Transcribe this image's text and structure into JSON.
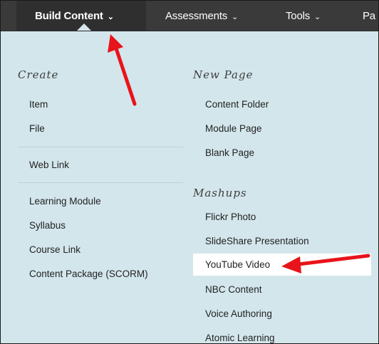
{
  "menubar": {
    "tabs": [
      {
        "label": "Build Content",
        "chevron": "⌄"
      },
      {
        "label": "Assessments",
        "chevron": "⌄"
      },
      {
        "label": "Tools",
        "chevron": "⌄"
      },
      {
        "label": "Pa"
      }
    ]
  },
  "dropdown": {
    "create": {
      "title": "Create",
      "items": [
        "Item",
        "File",
        "Web Link",
        "Learning Module",
        "Syllabus",
        "Course Link",
        "Content Package (SCORM)"
      ]
    },
    "new_page": {
      "title": "New Page",
      "items": [
        "Content Folder",
        "Module Page",
        "Blank Page"
      ]
    },
    "mashups": {
      "title": "Mashups",
      "items": [
        "Flickr Photo",
        "SlideShare Presentation",
        "YouTube Video",
        "NBC Content",
        "Voice Authoring",
        "Atomic Learning"
      ]
    }
  },
  "colors": {
    "menubar": "#3a3a3a",
    "dropdown_bg": "#d3e6ec",
    "highlight": "#ffffff",
    "annotation_arrow": "#e8141b"
  }
}
